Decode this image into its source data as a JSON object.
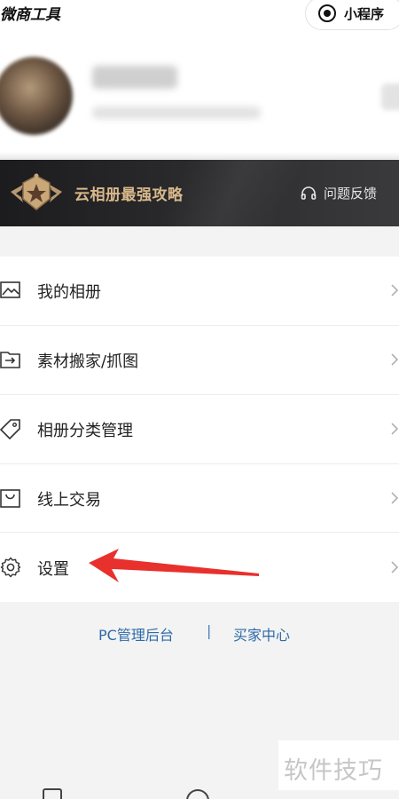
{
  "header": {
    "app_title": "微商工具",
    "mini_program_label": "小程序"
  },
  "banner": {
    "title": "云相册最强攻略",
    "feedback_label": "问题反馈"
  },
  "menu": {
    "items": [
      {
        "label": "我的相册",
        "icon": "image-icon"
      },
      {
        "label": "素材搬家/抓图",
        "icon": "folder-import-icon"
      },
      {
        "label": "相册分类管理",
        "icon": "tag-icon"
      },
      {
        "label": "线上交易",
        "icon": "shopping-bag-icon"
      },
      {
        "label": "设置",
        "icon": "gear-icon"
      }
    ]
  },
  "footer": {
    "pc_admin_label": "PC管理后台",
    "separator": "|",
    "buyer_center_label": "买家中心"
  },
  "watermark": "软件技巧",
  "colors": {
    "banner_gold": "#d9b98b",
    "link_blue": "#2d6aa8",
    "annotation_red": "#e8302c"
  }
}
